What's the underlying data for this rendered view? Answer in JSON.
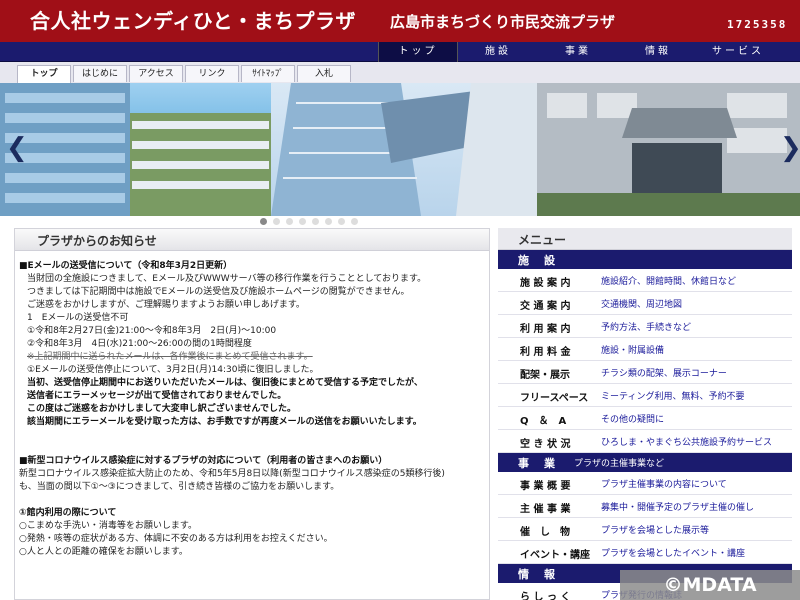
{
  "header": {
    "title": "合人社ウェンディひと・まちプラザ",
    "subtitle": "広島市まちづくり市民交流プラザ",
    "counter": "1725358"
  },
  "mainnav": [
    {
      "label": "トップ"
    },
    {
      "label": "施設"
    },
    {
      "label": "事業"
    },
    {
      "label": "情報"
    },
    {
      "label": "サービス"
    }
  ],
  "subtabs": [
    {
      "label": "トップ"
    },
    {
      "label": "はじめに"
    },
    {
      "label": "アクセス"
    },
    {
      "label": "リンク"
    },
    {
      "label": "ｻｲﾄﾏｯﾌﾟ"
    },
    {
      "label": "入札"
    }
  ],
  "carousel": {
    "prev_arrow": "❮",
    "next_arrow": "❯",
    "dot_count": 8,
    "active_index": 0
  },
  "notices": {
    "heading": "プラザからのお知らせ",
    "lines": [
      "■Eメールの送受信について（令和8年3月2日更新）",
      "当財団の全施設につきまして、Eメール及びWWWサーバ等の移行作業を行うこととしております。",
      "つきましては下記期間中は施設でEメールの送受信及び施設ホームページの閲覧ができません。",
      "ご迷惑をおかけしますが、ご理解賜りますようお願い申しあげます。",
      "1　Eメールの送受信不可",
      "①令和8年2月27日(金)21:00～令和8年3月　2日(月)～10:00",
      "②令和8年3月　4日(水)21:00～26:00の間の1時間程度",
      "※上記期間中に送られたメールは、各作業後にまとめて受信されます。",
      "①Eメールの送受信停止について、3月2日(月)14:30頃に復旧しました。",
      "当初、送受信停止期間中にお送りいただいたメールは、復旧後にまとめて受信する予定でしたが、",
      "送信者にエラーメッセージが出て受信されておりませんでした。",
      "この度はご迷惑をおかけしまして大変申し訳ございませんでした。",
      "該当期間にエラーメールを受け取った方は、お手数ですが再度メールの送信をお願いいたします。",
      "■新型コロナウイルス感染症に対するプラザの対応について（利用者の皆さまへのお願い）",
      "新型コロナウイルス感染症拡大防止のため、令和5年5月8日以降(新型コロナウイルス感染症の5類移行後)",
      "も、当面の間以下①～③につきまして、引き続き皆様のご協力をお願いします。",
      "①館内利用の際について",
      "○こまめな手洗い・消毒等をお願いします。",
      "○発熱・咳等の症状がある方、体調に不安のある方は利用をお控えください。",
      "○人と人との距離の確保をお願いします。"
    ]
  },
  "menu": {
    "heading": "メニュー",
    "sections": [
      {
        "label": "施　設",
        "desc": "",
        "items": [
          {
            "key": "施 設 案 内",
            "value": "施設紹介、開館時間、休館日など"
          },
          {
            "key": "交 通 案 内",
            "value": "交通機関、周辺地図"
          },
          {
            "key": "利 用 案 内",
            "value": "予約方法、手続きなど"
          },
          {
            "key": "利 用 料 金",
            "value": "施設・附属設備"
          },
          {
            "key": "配架・展示",
            "value": "チラシ類の配架、展示コーナー"
          },
          {
            "key": "フリースペース",
            "value": "ミーティング利用、無料、予約不要"
          },
          {
            "key": "Q　＆　A",
            "value": "その他の疑問に"
          },
          {
            "key": "空 き 状 況",
            "value": "ひろしま・やまぐち公共施設予約サービス"
          }
        ]
      },
      {
        "label": "事　業",
        "desc": "プラザの主催事業など",
        "items": [
          {
            "key": "事 業 概 要",
            "value": "プラザ主催事業の内容について"
          },
          {
            "key": "主 催 事 業",
            "value": "募集中・開催予定のプラザ主催の催し"
          },
          {
            "key": "催　し　物",
            "value": "プラザを会場とした展示等"
          },
          {
            "key": "イベント・講座",
            "value": "プラザを会場としたイベント・講座"
          }
        ]
      },
      {
        "label": "情　報",
        "desc": "",
        "items": [
          {
            "key": "ら し っ く",
            "value": "プラザ発行の情報誌"
          }
        ]
      }
    ]
  },
  "credit": "©MDATA",
  "colors": {
    "header_red": "#a00f17",
    "nav_navy": "#1b1b6e",
    "link_blue": "#1a1a9a"
  }
}
